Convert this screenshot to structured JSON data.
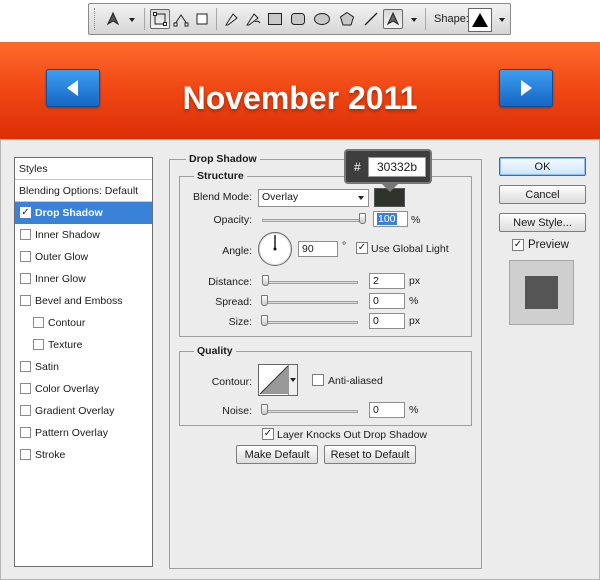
{
  "toolbar": {
    "shape_label": "Shape:",
    "tools": [
      "pen-tool",
      "path-selection",
      "rectangle-path",
      "pen",
      "freeform-pen",
      "rectangle",
      "rounded-rectangle",
      "ellipse",
      "polygon",
      "line",
      "custom-shape"
    ],
    "active_tool": "custom-shape"
  },
  "header": {
    "title": "November 2011",
    "prev_icon": "left-arrow-icon",
    "next_icon": "right-arrow-icon"
  },
  "styles_panel": {
    "title": "Styles",
    "blending_options": "Blending Options: Default",
    "items": [
      {
        "label": "Drop Shadow",
        "checked": true,
        "selected": true,
        "indent": false
      },
      {
        "label": "Inner Shadow",
        "checked": false,
        "selected": false,
        "indent": false
      },
      {
        "label": "Outer Glow",
        "checked": false,
        "selected": false,
        "indent": false
      },
      {
        "label": "Inner Glow",
        "checked": false,
        "selected": false,
        "indent": false
      },
      {
        "label": "Bevel and Emboss",
        "checked": false,
        "selected": false,
        "indent": false
      },
      {
        "label": "Contour",
        "checked": false,
        "selected": false,
        "indent": true
      },
      {
        "label": "Texture",
        "checked": false,
        "selected": false,
        "indent": true
      },
      {
        "label": "Satin",
        "checked": false,
        "selected": false,
        "indent": false
      },
      {
        "label": "Color Overlay",
        "checked": false,
        "selected": false,
        "indent": false
      },
      {
        "label": "Gradient Overlay",
        "checked": false,
        "selected": false,
        "indent": false
      },
      {
        "label": "Pattern Overlay",
        "checked": false,
        "selected": false,
        "indent": false
      },
      {
        "label": "Stroke",
        "checked": false,
        "selected": false,
        "indent": false
      }
    ]
  },
  "drop_shadow": {
    "section_title": "Drop Shadow",
    "structure_title": "Structure",
    "blend_mode_label": "Blend Mode:",
    "blend_mode_value": "Overlay",
    "shadow_color": "#30332b",
    "opacity_label": "Opacity:",
    "opacity_value": "100",
    "opacity_unit": "%",
    "angle_label": "Angle:",
    "angle_value": "90",
    "angle_unit": "°",
    "use_global_light_label": "Use Global Light",
    "use_global_light": true,
    "distance_label": "Distance:",
    "distance_value": "2",
    "distance_unit": "px",
    "spread_label": "Spread:",
    "spread_value": "0",
    "spread_unit": "%",
    "size_label": "Size:",
    "size_value": "0",
    "size_unit": "px",
    "quality_title": "Quality",
    "contour_label": "Contour:",
    "anti_aliased_label": "Anti-aliased",
    "anti_aliased": false,
    "noise_label": "Noise:",
    "noise_value": "0",
    "noise_unit": "%",
    "layer_knocks_out_label": "Layer Knocks Out Drop Shadow",
    "layer_knocks_out": true,
    "make_default_label": "Make Default",
    "reset_default_label": "Reset to Default"
  },
  "color_tooltip": {
    "hash": "#",
    "hex_value": "30332b"
  },
  "buttons": {
    "ok": "OK",
    "cancel": "Cancel",
    "new_style": "New Style...",
    "preview_label": "Preview",
    "preview_checked": true
  }
}
